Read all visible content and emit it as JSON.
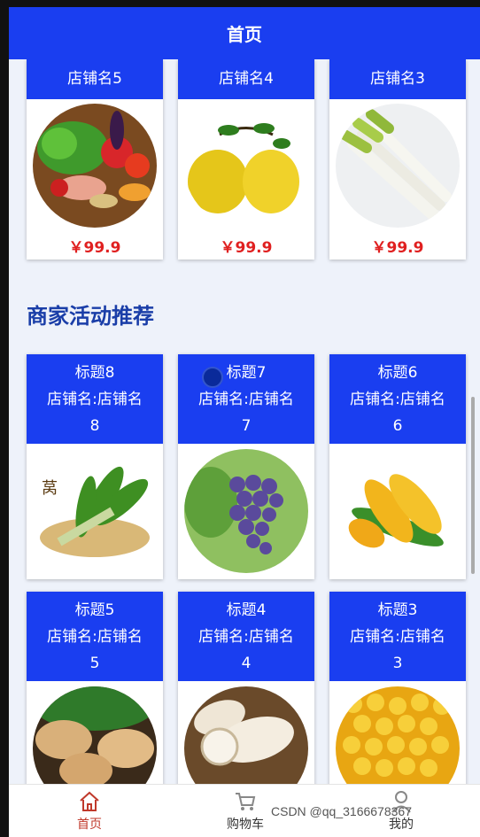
{
  "header": {
    "title": "首页"
  },
  "shops": [
    {
      "name": "店铺名5",
      "price": "￥99.9",
      "image": "vegetable-assortment-image"
    },
    {
      "name": "店铺名4",
      "price": "￥99.9",
      "image": "pomelo-image"
    },
    {
      "name": "店铺名3",
      "price": "￥99.9",
      "image": "green-onion-image"
    }
  ],
  "section": {
    "title": "商家活动推荐"
  },
  "promos": [
    {
      "title": "标题8",
      "shop_line1": "店铺名:店铺名",
      "shop_line2": "8",
      "image": "lettuce-image"
    },
    {
      "title": "标题7",
      "shop_line1": "店铺名:店铺名",
      "shop_line2": "7",
      "image": "grapes-image"
    },
    {
      "title": "标题6",
      "shop_line1": "店铺名:店铺名",
      "shop_line2": "6",
      "image": "corn-image"
    },
    {
      "title": "标题5",
      "shop_line1": "店铺名:店铺名",
      "shop_line2": "5",
      "image": "potato-image"
    },
    {
      "title": "标题4",
      "shop_line1": "店铺名:店铺名",
      "shop_line2": "4",
      "image": "yam-image"
    },
    {
      "title": "标题3",
      "shop_line1": "店铺名:店铺名",
      "shop_line2": "3",
      "image": "corn-kernels-image"
    }
  ],
  "tabbar": {
    "home": {
      "label": "首页",
      "icon": "home-icon"
    },
    "cart": {
      "label": "购物车",
      "icon": "cart-icon"
    },
    "mine": {
      "label": "我的",
      "icon": "user-icon"
    }
  },
  "watermark": "CSDN @qq_3166678367",
  "colors": {
    "primary": "#1a3ef0",
    "price": "#e02020",
    "section_title": "#1a3ea8",
    "active_tab": "#c0392b"
  }
}
